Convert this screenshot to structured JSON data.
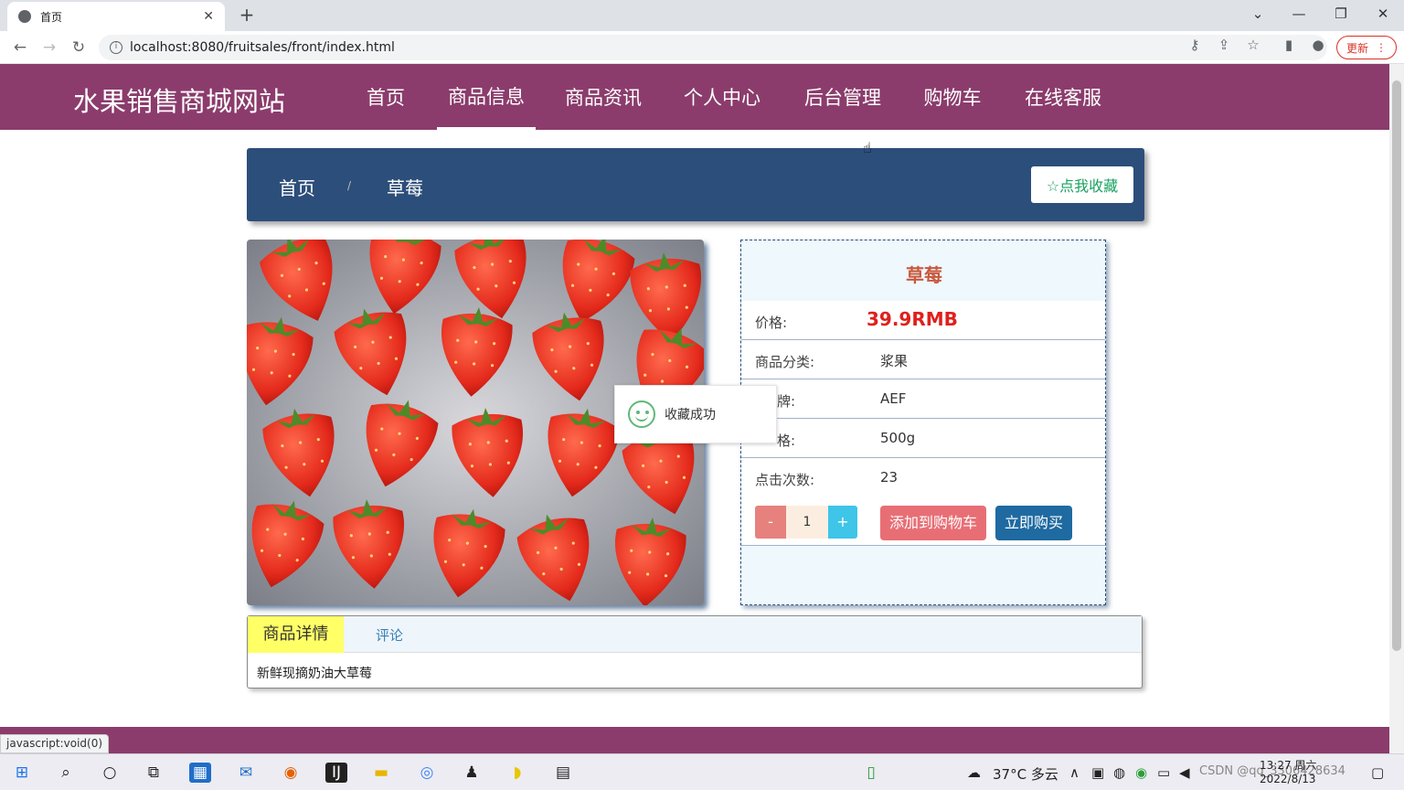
{
  "browser": {
    "tab_title": "首页",
    "close_tab": "✕",
    "new_tab": "+",
    "url": "localhost:8080/fruitsales/front/index.html",
    "update_label": "更新",
    "status_text": "javascript:void(0)"
  },
  "site": {
    "title": "水果销售商城网站",
    "menu": [
      "首页",
      "商品信息",
      "商品资讯",
      "个人中心",
      "后台管理",
      "购物车",
      "在线客服"
    ],
    "active_menu": "商品信息"
  },
  "breadcrumb": {
    "home": "首页",
    "separator": "/",
    "current": "草莓",
    "favorite_label": "☆点我收藏"
  },
  "product": {
    "name": "草莓",
    "rows": [
      {
        "label": "价格:",
        "value": "39.9RMB"
      },
      {
        "label": "商品分类:",
        "value": "浆果"
      },
      {
        "label": "牌:",
        "value": "AEF"
      },
      {
        "label": "格:",
        "value": "500g"
      },
      {
        "label": "点击次数:",
        "value": "23"
      }
    ],
    "quantity": "1",
    "minus_label": "-",
    "plus_label": "+",
    "add_cart_label": "添加到购物车",
    "buy_now_label": "立即购买"
  },
  "toast": {
    "text": "收藏成功"
  },
  "details": {
    "tab_detail": "商品详情",
    "tab_comment": "评论",
    "description": "新鲜现摘奶油大草莓"
  },
  "taskbar": {
    "weather": "37°C 多云",
    "time": "13:27 周六",
    "date": "2022/8/13",
    "watermark": "CSDN @qq_3306428634"
  },
  "colors": {
    "header_bg": "#8b3c6c",
    "breadcrumb_bg": "#2c4e7a",
    "price": "#e0201c",
    "product_name": "#c9583d",
    "add_cart": "#e86e75",
    "buy_now": "#1f6aa1"
  }
}
